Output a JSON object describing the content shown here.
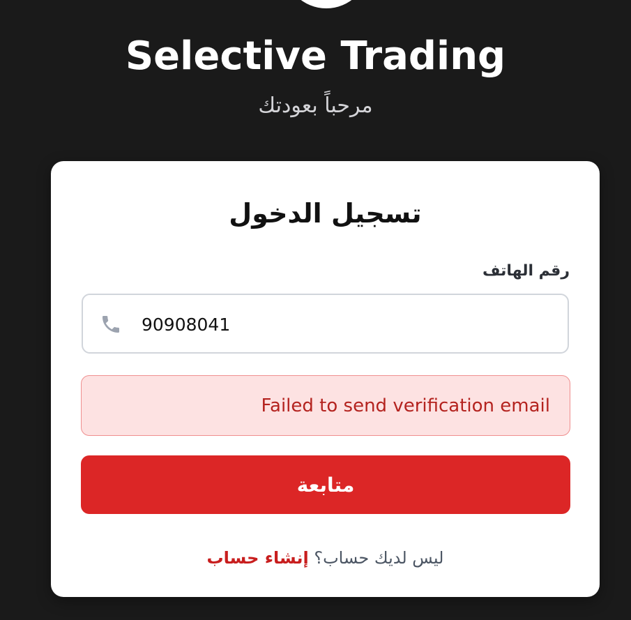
{
  "header": {
    "title": "Selective Trading",
    "welcome": "مرحباً بعودتك"
  },
  "login": {
    "title": "تسجيل الدخول",
    "phone_label": "رقم الهاتف",
    "phone_value": "90908041",
    "phone_icon": "phone-icon",
    "error_message": "Failed to send verification email",
    "continue_label": "متابعة",
    "no_account_text": "ليس لديك حساب؟",
    "signup_label": "إنشاء حساب"
  },
  "colors": {
    "background": "#1a1a1a",
    "card": "#ffffff",
    "primary": "#dc2626",
    "error_bg": "#fde2e2",
    "error_text": "#b4231f",
    "link": "#c81e1e"
  }
}
